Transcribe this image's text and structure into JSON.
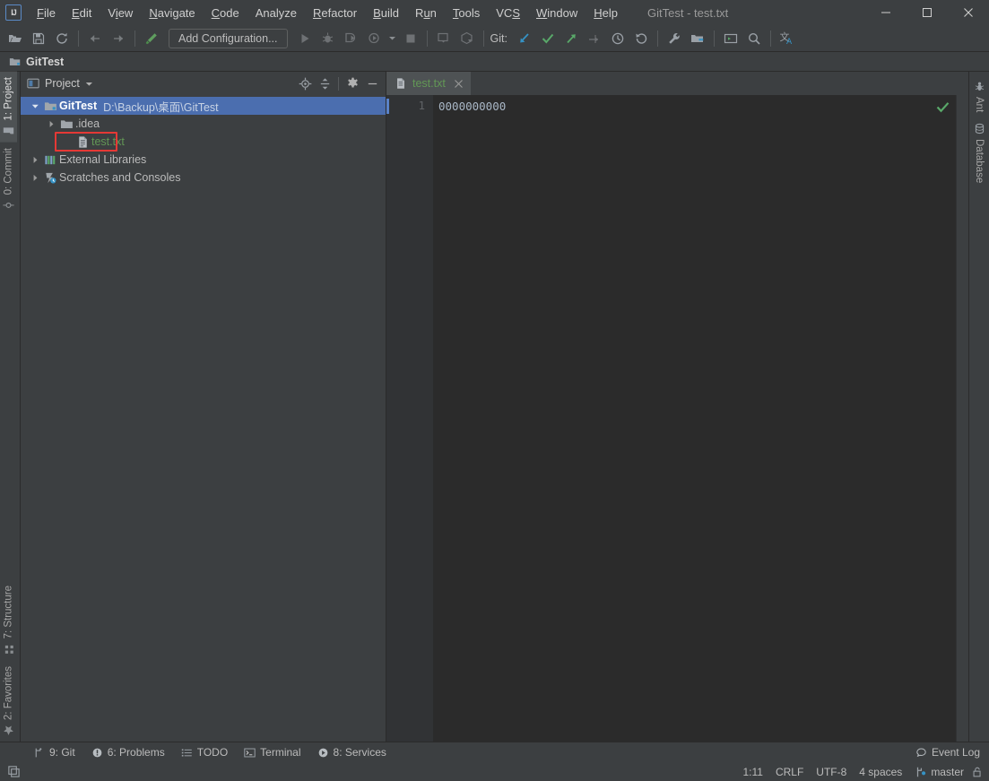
{
  "window": {
    "title": "GitTest - test.txt",
    "logo_text": "IJ",
    "controls": {
      "minimize": "—",
      "maximize": "□",
      "close": "✕"
    }
  },
  "menu": {
    "items": [
      {
        "label": "File",
        "mnemonic": "F"
      },
      {
        "label": "Edit",
        "mnemonic": "E"
      },
      {
        "label": "View",
        "mnemonic": "V"
      },
      {
        "label": "Navigate",
        "mnemonic": "N"
      },
      {
        "label": "Code",
        "mnemonic": "C"
      },
      {
        "label": "Analyze",
        "mnemonic": "A"
      },
      {
        "label": "Refactor",
        "mnemonic": "R"
      },
      {
        "label": "Build",
        "mnemonic": "B"
      },
      {
        "label": "Run",
        "mnemonic": "u"
      },
      {
        "label": "Tools",
        "mnemonic": "T"
      },
      {
        "label": "VCS",
        "mnemonic": "S"
      },
      {
        "label": "Window",
        "mnemonic": "W"
      },
      {
        "label": "Help",
        "mnemonic": "H"
      }
    ]
  },
  "toolbar": {
    "open_icon": "open-folder-icon",
    "save_icon": "save-icon",
    "sync_icon": "sync-icon",
    "back_icon": "back-arrow-icon",
    "forward_icon": "forward-arrow-icon",
    "build_icon": "build-hammer-icon",
    "run_config": "Add Configuration...",
    "run_icon": "run-icon",
    "debug_icon": "debug-icon",
    "run_coverage_icon": "run-with-coverage-icon",
    "profile_icon": "profiler-icon",
    "stop_icon": "stop-icon",
    "build_project_icon": "build-project-icon",
    "build_module_icon": "build-module-icon",
    "git_label": "Git:",
    "git_update_icon": "git-update-icon",
    "git_commit_icon": "git-commit-icon",
    "git_push_icon": "git-push-icon",
    "git_branch_icon": "git-branch-update-icon",
    "git_history_icon": "git-history-icon",
    "git_rollback_icon": "git-rollback-icon",
    "settings_icon": "wrench-settings-icon",
    "project_structure_icon": "project-structure-icon",
    "terminal_icon": "terminal-icon",
    "search_icon": "search-everywhere-icon",
    "translate_icon": "translate-icon"
  },
  "navbar": {
    "project": "GitTest"
  },
  "stripes": {
    "left_top": [
      {
        "label": "1: Project",
        "mnemonic": "1",
        "icon": "project-icon",
        "selected": true
      },
      {
        "label": "0: Commit",
        "mnemonic": "0",
        "icon": "commit-icon",
        "selected": false
      }
    ],
    "left_bottom": [
      {
        "label": "7: Structure",
        "mnemonic": "7",
        "icon": "structure-icon"
      },
      {
        "label": "2: Favorites",
        "mnemonic": "2",
        "icon": "favorites-star-icon"
      }
    ],
    "right": [
      {
        "label": "Ant",
        "icon": "ant-icon"
      },
      {
        "label": "Database",
        "icon": "database-icon"
      }
    ]
  },
  "project_panel": {
    "title": "Project",
    "dropdown_icon": "chevron-down-icon",
    "tools": [
      {
        "name": "select-opened-file",
        "icon": "locate-target-icon"
      },
      {
        "name": "collapse-all",
        "icon": "collapse-all-icon"
      },
      {
        "name": "panel-settings",
        "icon": "gear-icon"
      },
      {
        "name": "hide-panel",
        "icon": "minimize-icon"
      }
    ],
    "tree": [
      {
        "label": "GitTest",
        "path": "D:\\Backup\\桌面\\GitTest",
        "icon": "project-root-icon",
        "indent": 0,
        "expanded": true,
        "selected": true,
        "bold": true,
        "arrow": "▼"
      },
      {
        "label": ".idea",
        "path": "",
        "icon": "folder-icon",
        "indent": 1,
        "expanded": false,
        "selected": false,
        "bold": false,
        "arrow": "▶"
      },
      {
        "label": "test.txt",
        "path": "",
        "icon": "text-file-icon",
        "indent": 2,
        "expanded": false,
        "selected": false,
        "bold": false,
        "arrow": "",
        "vcs_status": "added",
        "highlighted": true
      },
      {
        "label": "External Libraries",
        "path": "",
        "icon": "libraries-icon",
        "indent": 0,
        "expanded": false,
        "selected": false,
        "bold": false,
        "arrow": "▶"
      },
      {
        "label": "Scratches and Consoles",
        "path": "",
        "icon": "scratches-icon",
        "indent": 0,
        "expanded": false,
        "selected": false,
        "bold": false,
        "arrow": "▶"
      }
    ]
  },
  "editor": {
    "tabs": [
      {
        "label": "test.txt",
        "icon": "text-file-icon",
        "active": true,
        "close_icon": "close-icon"
      }
    ],
    "lines": [
      {
        "number": "1",
        "text": "0000000000"
      }
    ],
    "inspection_status": "ok-check-icon"
  },
  "bottom_tool_windows": [
    {
      "label": "9: Git",
      "mnemonic": "9",
      "icon": "git-branch-icon"
    },
    {
      "label": "6: Problems",
      "mnemonic": "6",
      "icon": "problems-icon"
    },
    {
      "label": "TODO",
      "mnemonic": "",
      "icon": "todo-icon"
    },
    {
      "label": "Terminal",
      "mnemonic": "",
      "icon": "terminal-icon"
    },
    {
      "label": "8: Services",
      "mnemonic": "8",
      "icon": "services-icon"
    }
  ],
  "event_log": {
    "label": "Event Log",
    "icon": "event-log-icon"
  },
  "status_bar": {
    "left_icon": "toggle-toolwindows-icon",
    "caret_position": "1:11",
    "line_separator": "CRLF",
    "encoding": "UTF-8",
    "indent": "4 spaces",
    "branch": "master",
    "branch_icon": "git-branch-icon",
    "lock_icon": "read-only-lock-icon"
  },
  "colors": {
    "bg": "#3c3f41",
    "editor_bg": "#2b2b2b",
    "selection": "#4b6eaf",
    "accent_green": "#629755",
    "accent_blue": "#3592c4",
    "highlight_red": "#e53935",
    "text": "#bbbbbb"
  }
}
